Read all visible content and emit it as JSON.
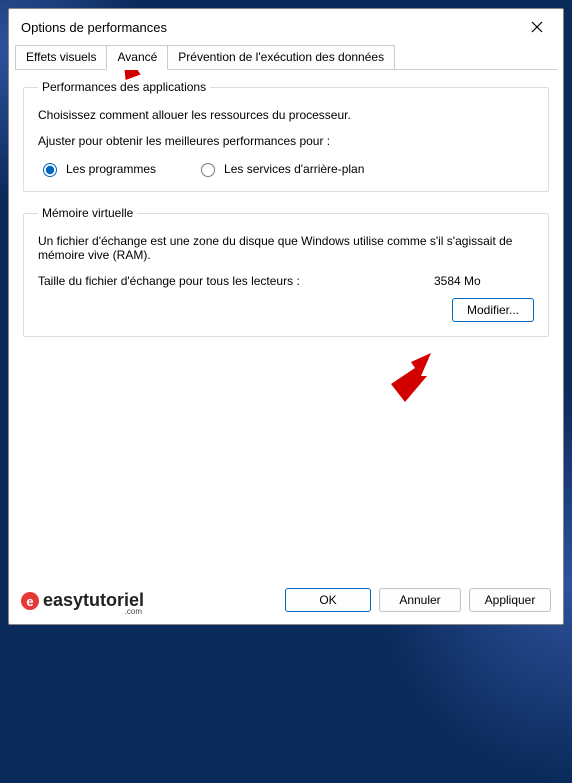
{
  "window": {
    "title": "Options de performances"
  },
  "tabs": {
    "visual": "Effets visuels",
    "advanced": "Avancé",
    "dep": "Prévention de l'exécution des données"
  },
  "appPerf": {
    "legend": "Performances des applications",
    "desc": "Choisissez comment allouer les ressources du processeur.",
    "adjustLabel": "Ajuster pour obtenir les meilleures performances pour :",
    "optPrograms": "Les programmes",
    "optServices": "Les services d'arrière-plan"
  },
  "vm": {
    "legend": "Mémoire virtuelle",
    "desc": "Un fichier d'échange est une zone du disque que Windows utilise comme s'il s'agissait de mémoire vive (RAM).",
    "sizeLabel": "Taille du fichier d'échange pour tous les lecteurs :",
    "sizeValue": "3584 Mo",
    "modifyBtn": "Modifier..."
  },
  "buttons": {
    "ok": "OK",
    "cancel": "Annuler",
    "apply": "Appliquer"
  },
  "brand": {
    "name": "easytutoriel",
    "dotcom": ".com"
  }
}
